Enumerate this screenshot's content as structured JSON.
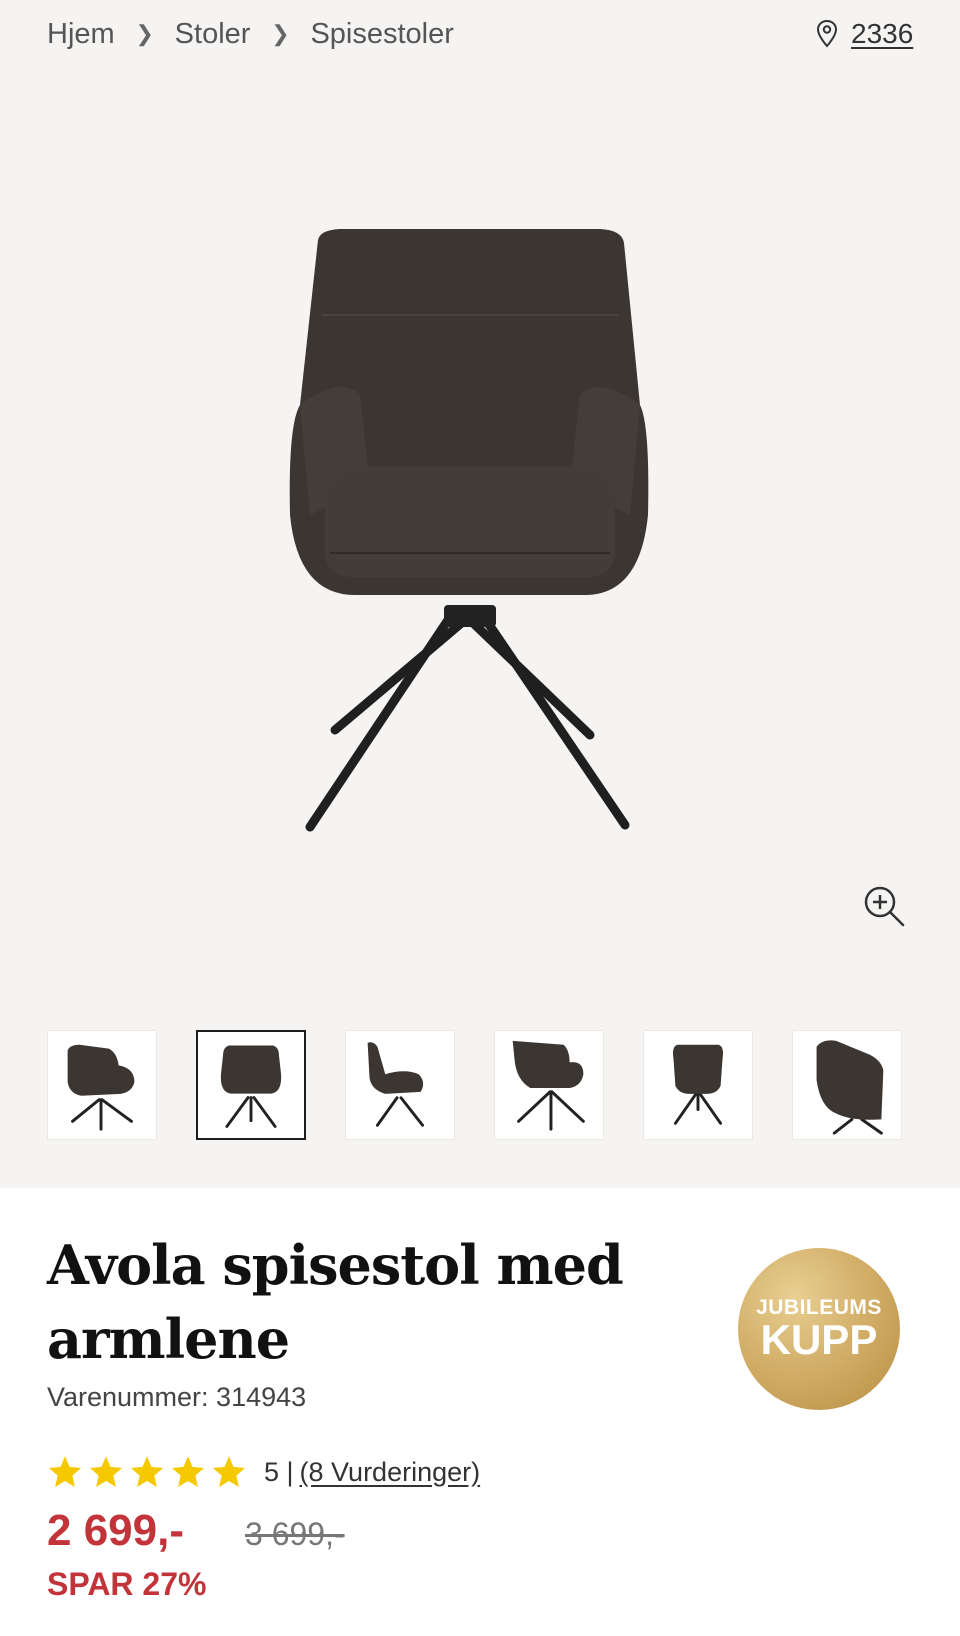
{
  "breadcrumb": {
    "items": [
      "Hjem",
      "Stoler",
      "Spisestoler"
    ],
    "separator": ">"
  },
  "store": {
    "icon": "location-pin-icon",
    "number": "2336"
  },
  "gallery": {
    "main_image": "dark-brown-armchair-front",
    "zoom_icon": "zoom-in-icon",
    "thumbnails": [
      {
        "view": "angled",
        "active": false
      },
      {
        "view": "front",
        "active": true
      },
      {
        "view": "side",
        "active": false
      },
      {
        "view": "back-angled",
        "active": false
      },
      {
        "view": "back",
        "active": false
      },
      {
        "view": "detail",
        "active": false
      }
    ]
  },
  "product": {
    "title": "Avola spisestol med armlene",
    "sku_label": "Varenummer: 314943",
    "rating": {
      "stars": 5,
      "score": "5 |",
      "reviews_label": "(8 Vurderinger)"
    },
    "price": "2 699,-",
    "old_price": "3 699,-",
    "savings": "SPAR 27%"
  },
  "badge": {
    "line1": "JUBILEUMS",
    "line2": "KUPP"
  },
  "colors": {
    "price_red": "#c3333a",
    "gallery_bg": "#f5f4f2",
    "star_yellow": "#f6c800",
    "badge_gold": "#d3b06a",
    "chair_brown": "#3a3531"
  }
}
